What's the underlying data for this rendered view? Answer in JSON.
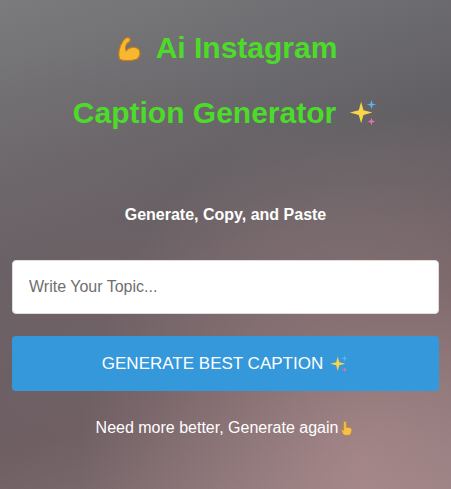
{
  "title": {
    "lines": [
      "Ai Instagram",
      "Caption Generator"
    ]
  },
  "subtitle": "Generate, Copy, and Paste",
  "topic_input": {
    "placeholder": "Write Your Topic...",
    "value": ""
  },
  "generate_button": {
    "label": "GENERATE BEST CAPTION"
  },
  "footer_hint": "Need more better, Generate again"
}
